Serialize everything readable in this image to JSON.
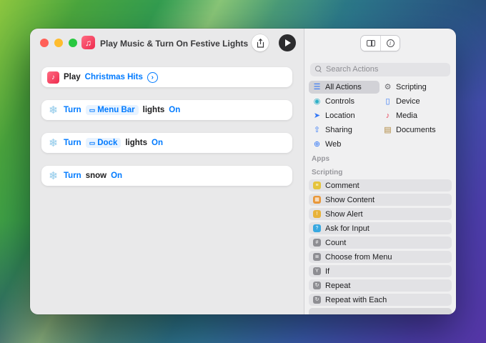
{
  "titlebar": {
    "title": "Play Music & Turn On Festive Lights",
    "icon_glyph": "♫"
  },
  "library": {
    "search_placeholder": "Search Actions",
    "categories": [
      {
        "label": "All Actions",
        "glyph": "☰",
        "color": "#3478f6",
        "selected": true
      },
      {
        "label": "Scripting",
        "glyph": "⚙",
        "color": "#6e6e73"
      },
      {
        "label": "Controls",
        "glyph": "◉",
        "color": "#2fb0c7"
      },
      {
        "label": "Device",
        "glyph": "▯",
        "color": "#3478f6"
      },
      {
        "label": "Location",
        "glyph": "➤",
        "color": "#3478f6"
      },
      {
        "label": "Media",
        "glyph": "♪",
        "color": "#e8455f"
      },
      {
        "label": "Sharing",
        "glyph": "⇧",
        "color": "#3478f6"
      },
      {
        "label": "Documents",
        "glyph": "▤",
        "color": "#b0883e"
      },
      {
        "label": "Web",
        "glyph": "⊕",
        "color": "#3478f6"
      }
    ],
    "section_apps": "Apps",
    "section_scripting": "Scripting",
    "scripting_actions": [
      {
        "label": "Comment",
        "glyph": "≡",
        "color": "#e5c43c"
      },
      {
        "label": "Show Content",
        "glyph": "▦",
        "color": "#e8973a"
      },
      {
        "label": "Show Alert",
        "glyph": "!",
        "color": "#e8b33a"
      },
      {
        "label": "Ask for Input",
        "glyph": "?",
        "color": "#38a8e0"
      },
      {
        "label": "Count",
        "glyph": "#",
        "color": "#8e8e93"
      },
      {
        "label": "Choose from Menu",
        "glyph": "≣",
        "color": "#8e8e93"
      },
      {
        "label": "If",
        "glyph": "Y",
        "color": "#8e8e93"
      },
      {
        "label": "Repeat",
        "glyph": "↻",
        "color": "#8e8e93"
      },
      {
        "label": "Repeat with Each",
        "glyph": "↻",
        "color": "#8e8e93"
      }
    ]
  },
  "editor": {
    "actions": [
      {
        "icon": "♪",
        "verb": "Play",
        "param": "Christmas Hits",
        "chevron": "›"
      },
      {
        "icon": "❄",
        "verb": "Turn",
        "token_icon": "▭",
        "token": "Menu Bar",
        "object": "lights",
        "state": "On"
      },
      {
        "icon": "❄",
        "verb": "Turn",
        "token_icon": "▭",
        "token": "Dock",
        "object": "lights",
        "state": "On"
      },
      {
        "icon": "❄",
        "verb": "Turn",
        "object": "snow",
        "state": "On"
      }
    ]
  },
  "colors": {
    "accent": "#007aff"
  }
}
